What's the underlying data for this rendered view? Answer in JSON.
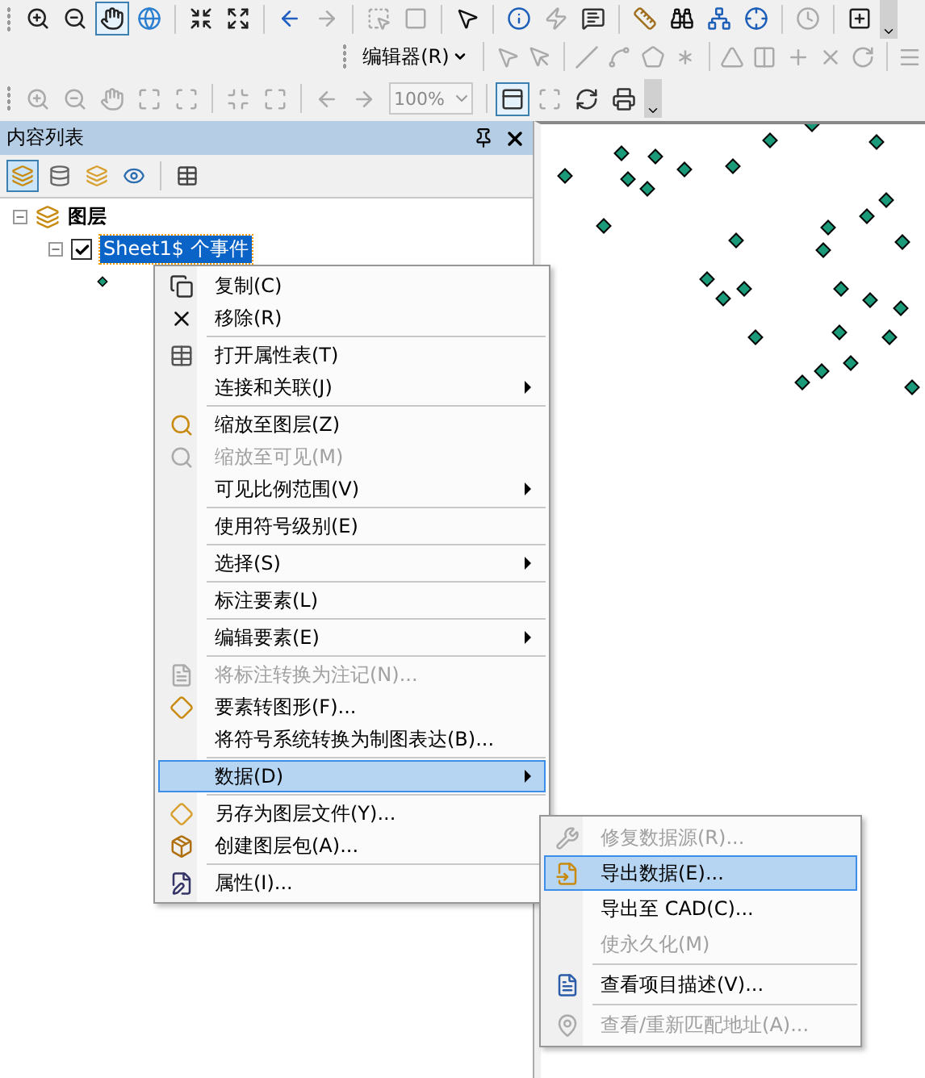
{
  "main_toolbar": {
    "tools": [
      {
        "selected": false,
        "disabled": false
      },
      {
        "selected": false,
        "disabled": false
      },
      {
        "selected": true,
        "disabled": false
      },
      {
        "selected": false,
        "disabled": false
      },
      {
        "selected": false,
        "disabled": false
      },
      {
        "selected": false,
        "disabled": false
      },
      {
        "selected": false,
        "disabled": false
      },
      {
        "selected": false,
        "disabled": true
      },
      {
        "selected": false,
        "disabled": true
      },
      {
        "selected": false,
        "disabled": true
      },
      {
        "selected": false,
        "disabled": false
      },
      {
        "selected": false,
        "disabled": false
      },
      {
        "selected": false,
        "disabled": true
      },
      {
        "selected": false,
        "disabled": false
      },
      {
        "selected": false,
        "disabled": false
      },
      {
        "selected": false,
        "disabled": false
      },
      {
        "selected": false,
        "disabled": false
      },
      {
        "selected": false,
        "disabled": false
      },
      {
        "selected": false,
        "disabled": true
      },
      {
        "selected": false,
        "disabled": false
      }
    ]
  },
  "editor_toolbar": {
    "menu_label": "编辑器(R)",
    "tools": [
      {
        "disabled": true
      },
      {
        "disabled": true
      },
      {
        "disabled": true
      },
      {
        "disabled": true
      },
      {
        "disabled": true
      },
      {
        "disabled": true
      },
      {
        "disabled": true
      },
      {
        "disabled": true
      },
      {
        "disabled": true
      },
      {
        "disabled": true
      },
      {
        "disabled": true
      },
      {
        "disabled": true
      }
    ]
  },
  "layout_toolbar": {
    "zoom_value": "100%",
    "tools": [
      {
        "selected": false,
        "disabled": true
      },
      {
        "selected": false,
        "disabled": true
      },
      {
        "selected": false,
        "disabled": true
      },
      {
        "selected": false,
        "disabled": true
      },
      {
        "selected": false,
        "disabled": true
      },
      {
        "selected": false,
        "disabled": true
      },
      {
        "selected": false,
        "disabled": true
      },
      {
        "selected": false,
        "disabled": true
      },
      {
        "selected": false,
        "disabled": true
      },
      {
        "selected": true,
        "disabled": false
      },
      {
        "selected": false,
        "disabled": true
      },
      {
        "selected": false,
        "disabled": false
      },
      {
        "selected": false,
        "disabled": false
      }
    ]
  },
  "toc": {
    "title": "内容列表",
    "view_tabs": [
      {
        "selected": true
      },
      {
        "selected": false
      },
      {
        "selected": false
      },
      {
        "selected": false
      },
      {
        "selected": false
      }
    ],
    "tree": [
      {
        "label": "图层",
        "expanded": true,
        "children": [
          {
            "label": "Sheet1$ 个事件",
            "expanded": true,
            "checked": true,
            "selected": true
          }
        ]
      }
    ]
  },
  "context_menu": {
    "items": [
      {
        "kind": "item",
        "label": "复制(C)",
        "disabled": false,
        "submenu": false,
        "selected": false
      },
      {
        "kind": "item",
        "label": "移除(R)",
        "disabled": false,
        "submenu": false,
        "selected": false
      },
      {
        "kind": "separator"
      },
      {
        "kind": "item",
        "label": "打开属性表(T)",
        "disabled": false,
        "submenu": false,
        "selected": false
      },
      {
        "kind": "item",
        "label": "连接和关联(J)",
        "disabled": false,
        "submenu": true,
        "selected": false
      },
      {
        "kind": "separator"
      },
      {
        "kind": "item",
        "label": "缩放至图层(Z)",
        "disabled": false,
        "submenu": false,
        "selected": false
      },
      {
        "kind": "item",
        "label": "缩放至可见(M)",
        "disabled": true,
        "submenu": false,
        "selected": false
      },
      {
        "kind": "item",
        "label": "可见比例范围(V)",
        "disabled": false,
        "submenu": true,
        "selected": false
      },
      {
        "kind": "separator"
      },
      {
        "kind": "item",
        "label": "使用符号级别(E)",
        "disabled": false,
        "submenu": false,
        "selected": false
      },
      {
        "kind": "separator"
      },
      {
        "kind": "item",
        "label": "选择(S)",
        "disabled": false,
        "submenu": true,
        "selected": false
      },
      {
        "kind": "separator"
      },
      {
        "kind": "item",
        "label": "标注要素(L)",
        "disabled": false,
        "submenu": false,
        "selected": false
      },
      {
        "kind": "separator"
      },
      {
        "kind": "item",
        "label": "编辑要素(E)",
        "disabled": false,
        "submenu": true,
        "selected": false
      },
      {
        "kind": "separator"
      },
      {
        "kind": "item",
        "label": "将标注转换为注记(N)...",
        "disabled": true,
        "submenu": false,
        "selected": false
      },
      {
        "kind": "item",
        "label": "要素转图形(F)...",
        "disabled": false,
        "submenu": false,
        "selected": false
      },
      {
        "kind": "item",
        "label": "将符号系统转换为制图表达(B)...",
        "disabled": false,
        "submenu": false,
        "selected": false
      },
      {
        "kind": "separator"
      },
      {
        "kind": "item",
        "label": "数据(D)",
        "disabled": false,
        "submenu": true,
        "selected": true
      },
      {
        "kind": "separator"
      },
      {
        "kind": "item",
        "label": "另存为图层文件(Y)...",
        "disabled": false,
        "submenu": false,
        "selected": false
      },
      {
        "kind": "item",
        "label": "创建图层包(A)...",
        "disabled": false,
        "submenu": false,
        "selected": false
      },
      {
        "kind": "separator"
      },
      {
        "kind": "item",
        "label": "属性(I)...",
        "disabled": false,
        "submenu": false,
        "selected": false
      }
    ]
  },
  "data_submenu": {
    "items": [
      {
        "kind": "item",
        "label": "修复数据源(R)...",
        "disabled": true,
        "selected": false
      },
      {
        "kind": "item",
        "label": "导出数据(E)...",
        "disabled": false,
        "selected": true
      },
      {
        "kind": "item",
        "label": "导出至 CAD(C)...",
        "disabled": false,
        "selected": false
      },
      {
        "kind": "item",
        "label": "使永久化(M)",
        "disabled": true,
        "selected": false
      },
      {
        "kind": "separator"
      },
      {
        "kind": "item",
        "label": "查看项目描述(V)...",
        "disabled": false,
        "selected": false
      },
      {
        "kind": "separator"
      },
      {
        "kind": "item",
        "label": "查看/重新匹配地址(A)...",
        "disabled": true,
        "selected": false
      }
    ]
  }
}
